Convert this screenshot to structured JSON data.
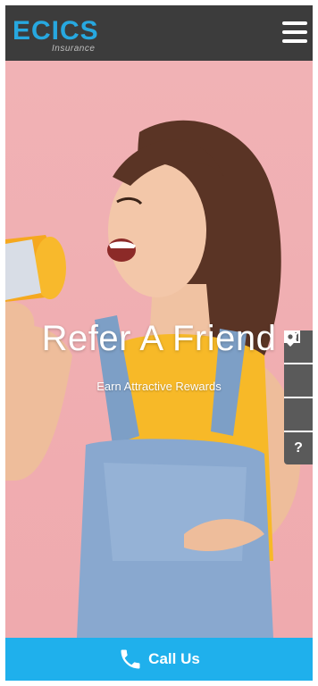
{
  "header": {
    "logo_main": "ECICS",
    "logo_sub": "Insurance",
    "menu_icon": "hamburger-icon"
  },
  "hero": {
    "title": "Refer A Friend",
    "subtitle": "Earn Attractive Rewards"
  },
  "side_tabs": [
    {
      "icon": "mail-icon"
    },
    {
      "icon": "phone-icon"
    },
    {
      "icon": "location-pin-icon"
    },
    {
      "icon": "help-icon",
      "glyph": "?"
    }
  ],
  "call_bar": {
    "label": "Call Us",
    "icon": "phone-icon"
  },
  "colors": {
    "header_bg": "#3c3c3c",
    "brand_blue": "#27a8e0",
    "call_bar_bg": "#1fb0ec",
    "hero_bg": "#f1b2b5",
    "side_tab_bg": "#5a5a5a"
  }
}
